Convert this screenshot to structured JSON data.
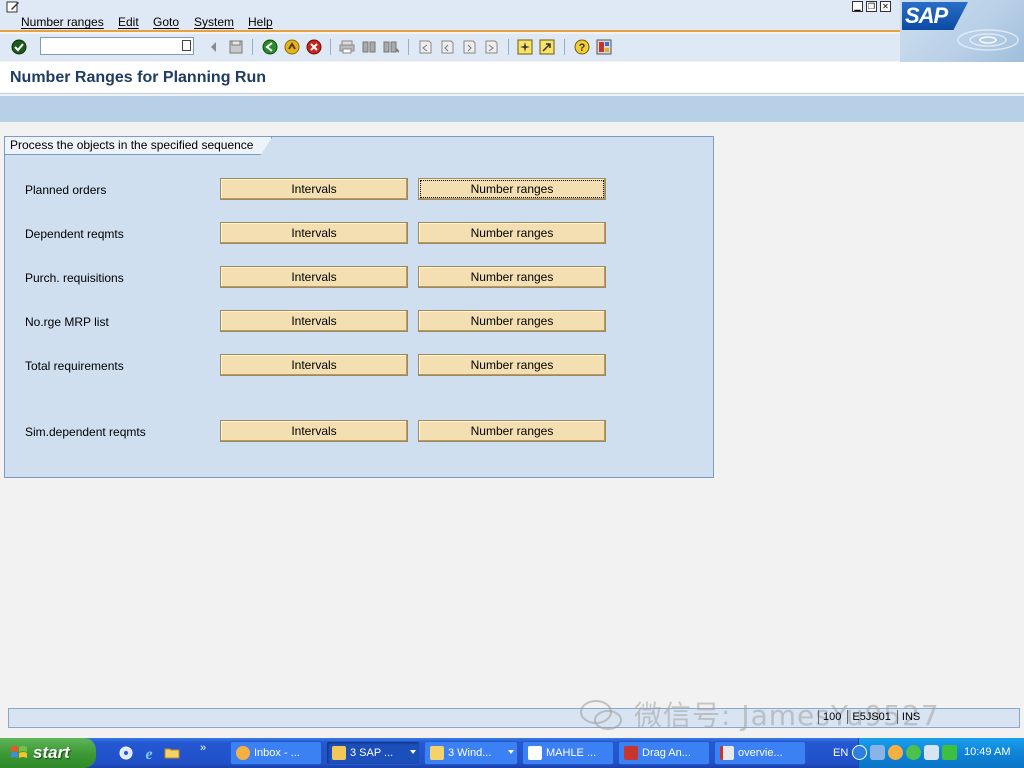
{
  "menu": {
    "items": [
      "Number ranges",
      "Edit",
      "Goto",
      "System",
      "Help"
    ]
  },
  "window_controls": [
    "minimize-icon",
    "restore-icon",
    "close-icon"
  ],
  "logo": {
    "text": "SAP"
  },
  "toolbar": {
    "command_field": {
      "value": "",
      "placeholder": ""
    },
    "icons": [
      "enter-icon",
      "back-arrow-icon",
      "save-icon",
      "back-icon",
      "exit-icon",
      "cancel-icon",
      "print-icon",
      "find-icon",
      "find-next-icon",
      "first-page-icon",
      "previous-page-icon",
      "next-page-icon",
      "last-page-icon",
      "create-session-icon",
      "shortcut-icon",
      "help-icon",
      "layout-menu-icon"
    ]
  },
  "page": {
    "title": "Number Ranges for Planning Run"
  },
  "group": {
    "title": "Process the objects in the specified sequence",
    "rows": [
      {
        "label": "Planned orders",
        "intervals": "Intervals",
        "number_ranges": "Number ranges"
      },
      {
        "label": "Dependent reqmts",
        "intervals": "Intervals",
        "number_ranges": "Number ranges"
      },
      {
        "label": "Purch. requisitions",
        "intervals": "Intervals",
        "number_ranges": "Number ranges"
      },
      {
        "label": "No.rge MRP list",
        "intervals": "Intervals",
        "number_ranges": "Number ranges"
      },
      {
        "label": "Total requirements",
        "intervals": "Intervals",
        "number_ranges": "Number ranges"
      },
      {
        "label": "Sim.dependent reqmts",
        "intervals": "Intervals",
        "number_ranges": "Number ranges"
      }
    ]
  },
  "status": {
    "client": "100",
    "server": "E5JS01",
    "mode": "INS",
    "watermark": "微信号: JamesYu9527"
  },
  "taskbar": {
    "start_label": "start",
    "tasks": [
      {
        "label": "Inbox - ...",
        "icon_color": "#f6b042"
      },
      {
        "label": "3 SAP ...",
        "icon_color": "#f3c85a"
      },
      {
        "label": "3 Wind...",
        "icon_color": "#f6d26a"
      },
      {
        "label": "MAHLE ...",
        "icon_color": "#ffffff"
      },
      {
        "label": "Drag An...",
        "icon_color": "#c7352f"
      },
      {
        "label": "overvie...",
        "icon_color": "#e8e8e8"
      }
    ],
    "language": "EN",
    "clock": "10:49 AM"
  },
  "colors": {
    "menu_bg": "#dfe9f5",
    "group_bg": "#d0dff0",
    "button_bg": "#f4dfb2",
    "title_color": "#1f3c62",
    "taskbar_blue": "#2458d2",
    "start_green": "#3d9a35"
  }
}
